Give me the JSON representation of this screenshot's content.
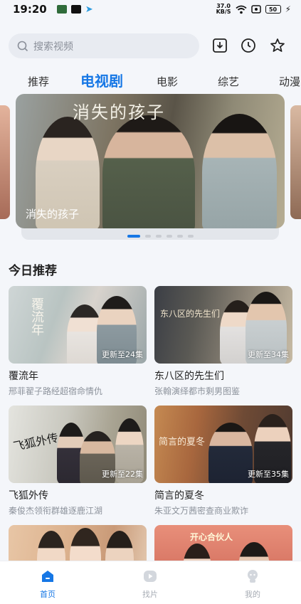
{
  "status_bar": {
    "time": "19:20",
    "net_speed_value": "37.0",
    "net_speed_unit": "KB/S",
    "battery": "50"
  },
  "search": {
    "placeholder": "搜索视频"
  },
  "tabs": [
    {
      "label": "推荐"
    },
    {
      "label": "电视剧"
    },
    {
      "label": "电影"
    },
    {
      "label": "综艺"
    },
    {
      "label": "动漫"
    }
  ],
  "banner": {
    "art_title": "消失的孩子",
    "caption": "消失的孩子",
    "page_count": 6,
    "active_page": 1
  },
  "section": {
    "title": "今日推荐"
  },
  "cards": [
    {
      "title": "覆流年",
      "subtitle": "邢菲翟子路经超宿命情仇",
      "badge": "更新至24集",
      "art": "覆流年"
    },
    {
      "title": "东八区的先生们",
      "subtitle": "张翰演绎都市剩男图鉴",
      "badge": "更新至34集",
      "art": "东八区的先生们"
    },
    {
      "title": "飞狐外传",
      "subtitle": "秦俊杰领衔群雄逐鹿江湖",
      "badge": "更新至22集",
      "art": "飞狐外传"
    },
    {
      "title": "简言的夏冬",
      "subtitle": "朱亚文万茜密查商业欺诈",
      "badge": "更新至35集",
      "art": "简言的夏冬"
    },
    {
      "title": "",
      "subtitle": "",
      "badge": "",
      "art": ""
    },
    {
      "title": "",
      "subtitle": "",
      "badge": "",
      "art": "开心合伙人"
    }
  ],
  "bottom_nav": [
    {
      "label": "首页",
      "icon": "home-icon",
      "active": true
    },
    {
      "label": "找片",
      "icon": "discover-icon",
      "active": false
    },
    {
      "label": "我的",
      "icon": "profile-icon",
      "active": false
    }
  ],
  "colors": {
    "accent": "#1677e5",
    "background": "#f4f6fa"
  }
}
